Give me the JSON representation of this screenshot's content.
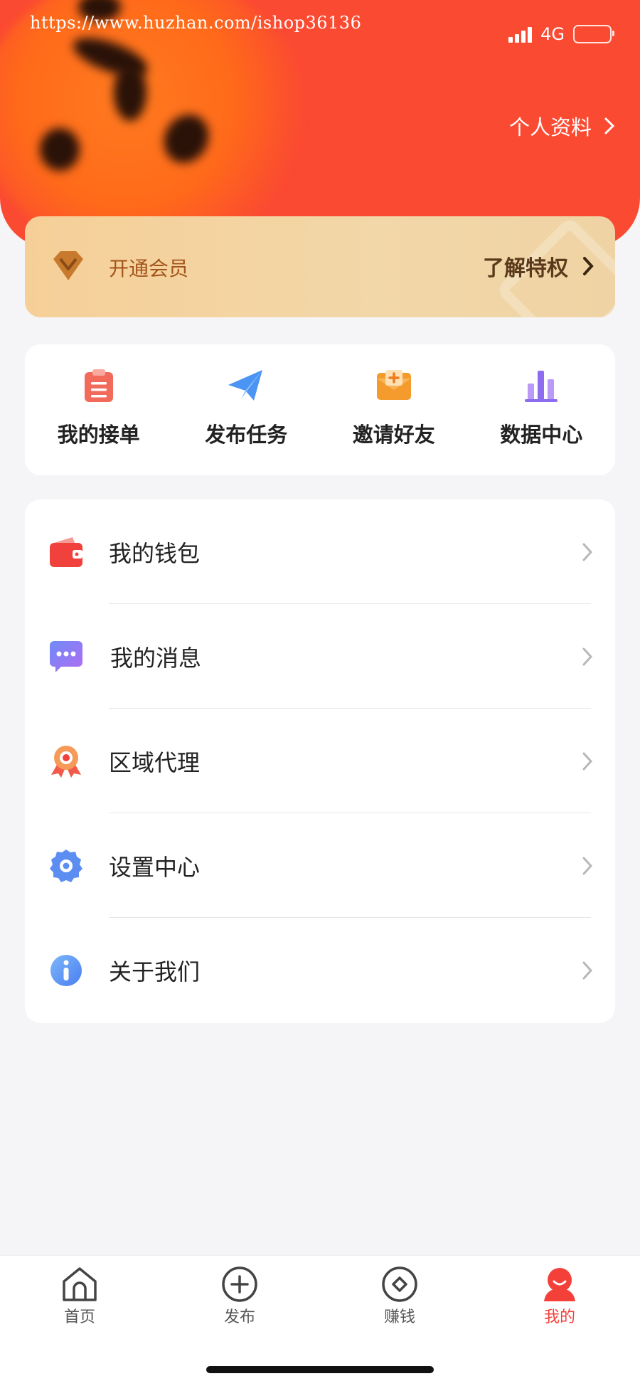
{
  "status_bar": {
    "watermark": "https://www.huzhan.com/ishop36136",
    "network": "4G"
  },
  "header": {
    "profile_link": "个人资料"
  },
  "vip": {
    "label": "开通会员",
    "more": "了解特权"
  },
  "shortcuts": [
    {
      "label": "我的接单",
      "icon": "clipboard-icon"
    },
    {
      "label": "发布任务",
      "icon": "paper-plane-icon"
    },
    {
      "label": "邀请好友",
      "icon": "invite-envelope-icon"
    },
    {
      "label": "数据中心",
      "icon": "bar-chart-icon"
    }
  ],
  "menu": [
    {
      "label": "我的钱包",
      "icon": "wallet-icon"
    },
    {
      "label": "我的消息",
      "icon": "message-icon"
    },
    {
      "label": "区域代理",
      "icon": "medal-icon"
    },
    {
      "label": "设置中心",
      "icon": "gear-icon"
    },
    {
      "label": "关于我们",
      "icon": "info-icon"
    }
  ],
  "tabbar": [
    {
      "label": "首页",
      "icon": "home-icon"
    },
    {
      "label": "发布",
      "icon": "plus-circle-icon"
    },
    {
      "label": "赚钱",
      "icon": "coin-icon"
    },
    {
      "label": "我的",
      "icon": "user-icon",
      "active": true
    }
  ],
  "colors": {
    "primary": "#fb4a32",
    "vip_gold": "#f4d3a0",
    "active_tab": "#f3413a"
  }
}
